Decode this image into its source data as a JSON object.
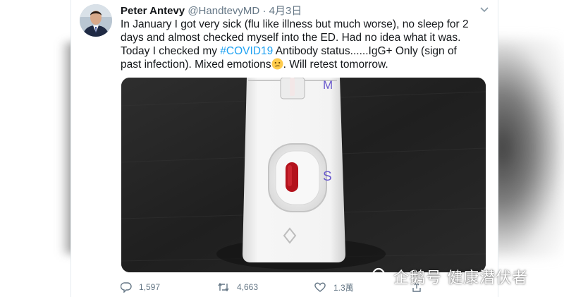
{
  "tweet": {
    "author_name": "Peter Antevy",
    "author_handle": "@HandtevyMD",
    "separator": "·",
    "date": "4月3日",
    "text_line_1": "In January I got very sick (flu like illness but much worse), no sleep for 2",
    "text_line_2": "days and almost checked myself into the ED.  Had no idea what it was.",
    "text_line_3_prefix": "Today I checked my ",
    "hashtag": "#COVID19",
    "text_line_3_suffix": " Antibody status......IgG+ Only (sign of",
    "text_line_4_prefix": "past infection).  Mixed emotions",
    "text_line_4_suffix": ".  Will retest tomorrow."
  },
  "media": {
    "label_m": "M",
    "label_s": "S"
  },
  "actions": {
    "replies": "1,597",
    "retweets": "4,663",
    "likes": "1.3萬"
  },
  "watermark": {
    "text": "企鹅号 健康潜伏者"
  },
  "colors": {
    "link": "#1da1f2",
    "text": "#14171a",
    "secondary": "#657786",
    "test_dot": "#b3121c",
    "test_letters": "#6a5acd"
  },
  "icons": [
    "caret-down-icon",
    "reply-icon",
    "retweet-icon",
    "like-icon",
    "share-icon",
    "penguin-icon",
    "confused-face-icon"
  ]
}
